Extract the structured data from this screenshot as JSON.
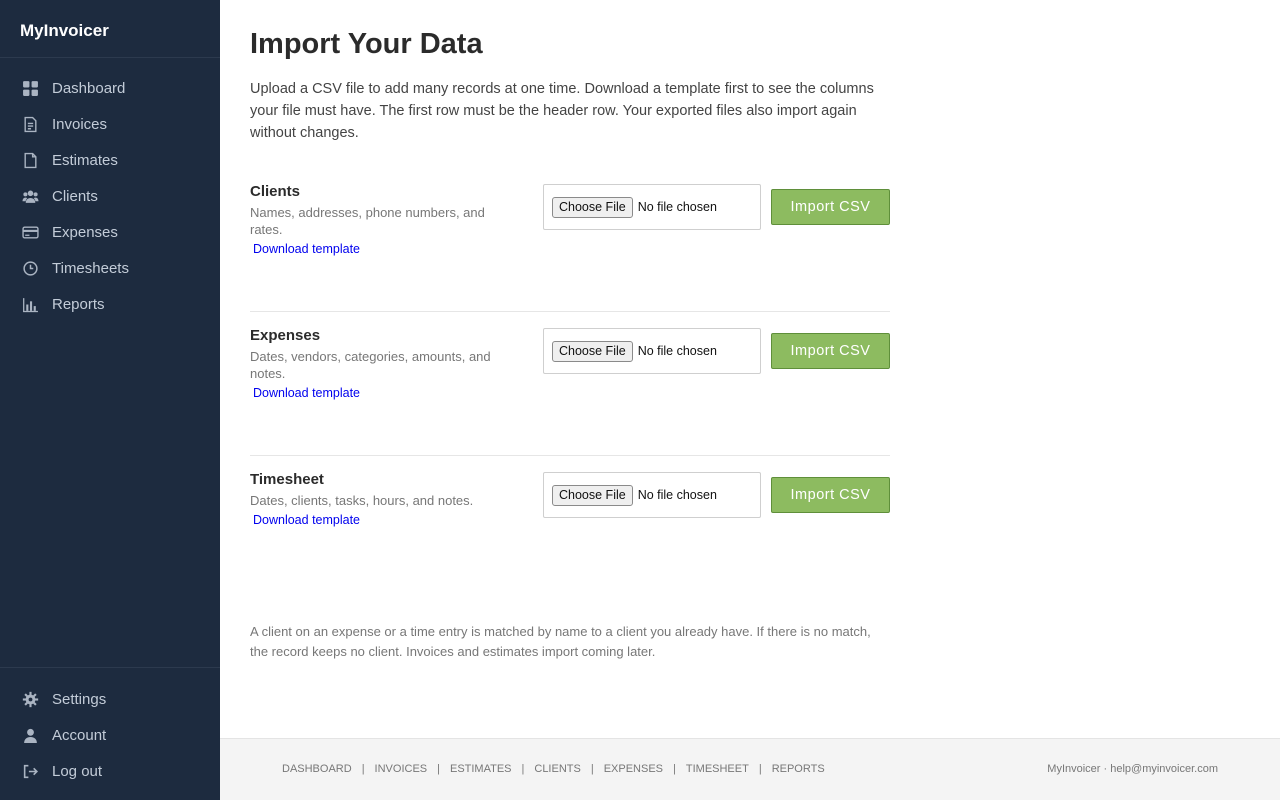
{
  "app": {
    "name": "MyInvoicer"
  },
  "sidebar": {
    "items": [
      {
        "label": "Dashboard",
        "icon": "dashboard-icon"
      },
      {
        "label": "Invoices",
        "icon": "invoice-icon"
      },
      {
        "label": "Estimates",
        "icon": "estimate-icon"
      },
      {
        "label": "Clients",
        "icon": "clients-icon"
      },
      {
        "label": "Expenses",
        "icon": "credit-card-icon"
      },
      {
        "label": "Timesheets",
        "icon": "clock-icon"
      },
      {
        "label": "Reports",
        "icon": "bar-chart-icon"
      }
    ],
    "bottom_items": [
      {
        "label": "Settings",
        "icon": "gear-icon"
      },
      {
        "label": "Account",
        "icon": "user-icon"
      },
      {
        "label": "Log out",
        "icon": "logout-icon"
      }
    ]
  },
  "page": {
    "title": "Import Your Data",
    "intro": "Upload a CSV file to add many records at one time. Download a template first to see the columns your file must have. The first row must be the header row. Your exported files also import again without changes."
  },
  "sections": [
    {
      "title": "Clients",
      "description": "Names, addresses, phone numbers, and rates.",
      "link": "Download template",
      "choose_label": "Choose File",
      "file_status": "No file chosen",
      "import_label": "Import CSV"
    },
    {
      "title": "Expenses",
      "description": "Dates, vendors, categories, amounts, and notes.",
      "link": "Download template",
      "choose_label": "Choose File",
      "file_status": "No file chosen",
      "import_label": "Import CSV"
    },
    {
      "title": "Timesheet",
      "description": "Dates, clients, tasks, hours, and notes.",
      "link": "Download template",
      "choose_label": "Choose File",
      "file_status": "No file chosen",
      "import_label": "Import CSV"
    }
  ],
  "note": "A client on an expense or a time entry is matched by name to a client you already have. If there is no match, the record keeps no client. Invoices and estimates import coming later.",
  "footer": {
    "links": [
      "DASHBOARD",
      "INVOICES",
      "ESTIMATES",
      "CLIENTS",
      "EXPENSES",
      "TIMESHEET",
      "REPORTS"
    ],
    "separator": "|",
    "right_text": "MyInvoicer · help@myinvoicer.com"
  },
  "colors": {
    "sidebar_bg": "#1d2b3f",
    "import_button": "#8dbb60",
    "link": "#0000ee",
    "footer_bg": "#f4f4f4"
  }
}
